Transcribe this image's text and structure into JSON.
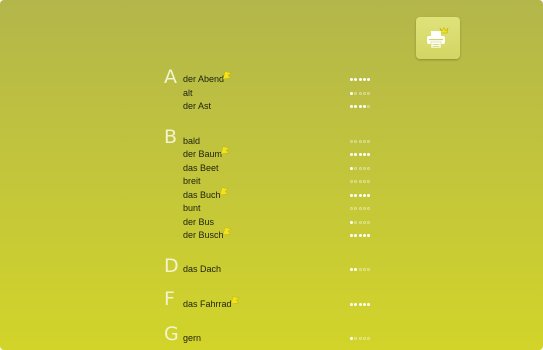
{
  "toolbar": {
    "print_icon": "printer-icon",
    "badge_icon": "crown-icon"
  },
  "colors": {
    "background": "#c1c43c",
    "flag": "#f3e41a",
    "dot_filled": "#ffffff"
  },
  "sections": [
    {
      "letter": "A",
      "entries": [
        {
          "word": "der Abend",
          "flagged": true,
          "rating": 5
        },
        {
          "word": "alt",
          "flagged": false,
          "rating": 1
        },
        {
          "word": "der Ast",
          "flagged": false,
          "rating": 4
        }
      ]
    },
    {
      "letter": "B",
      "entries": [
        {
          "word": "bald",
          "flagged": false,
          "rating": 0
        },
        {
          "word": "der Baum",
          "flagged": true,
          "rating": 5
        },
        {
          "word": "das Beet",
          "flagged": false,
          "rating": 1
        },
        {
          "word": "breit",
          "flagged": false,
          "rating": 0
        },
        {
          "word": "das Buch",
          "flagged": true,
          "rating": 5
        },
        {
          "word": "bunt",
          "flagged": false,
          "rating": 0
        },
        {
          "word": "der Bus",
          "flagged": false,
          "rating": 1
        },
        {
          "word": "der Busch",
          "flagged": true,
          "rating": 5
        }
      ]
    },
    {
      "letter": "D",
      "entries": [
        {
          "word": "das Dach",
          "flagged": false,
          "rating": 2
        }
      ]
    },
    {
      "letter": "F",
      "entries": [
        {
          "word": "das Fahrrad",
          "flagged": true,
          "rating": 5
        }
      ]
    },
    {
      "letter": "G",
      "entries": [
        {
          "word": "gern",
          "flagged": false,
          "rating": 1
        }
      ]
    }
  ]
}
